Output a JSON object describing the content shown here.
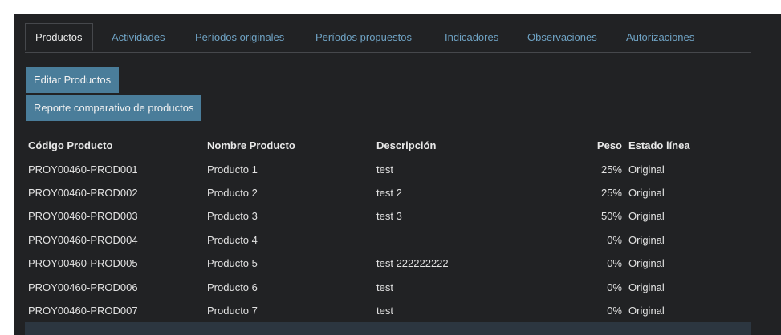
{
  "tabs": [
    {
      "label": "Productos",
      "active": true
    },
    {
      "label": "Actividades"
    },
    {
      "label": "Períodos originales"
    },
    {
      "label": "Períodos propuestos"
    },
    {
      "label": "Indicadores"
    },
    {
      "label": "Observaciones"
    },
    {
      "label": "Autorizaciones"
    }
  ],
  "buttons": {
    "edit": "Editar Productos",
    "report": "Reporte comparativo de productos"
  },
  "table": {
    "headers": {
      "code": "Código Producto",
      "name": "Nombre Producto",
      "desc": "Descripción",
      "peso": "Peso",
      "estado": "Estado línea"
    },
    "rows": [
      {
        "code": "PROY00460-PROD001",
        "name": "Producto 1",
        "desc": "test",
        "peso": "25%",
        "estado": "Original"
      },
      {
        "code": "PROY00460-PROD002",
        "name": "Producto 2",
        "desc": "test 2",
        "peso": "25%",
        "estado": "Original"
      },
      {
        "code": "PROY00460-PROD003",
        "name": "Producto 3",
        "desc": "test 3",
        "peso": "50%",
        "estado": "Original"
      },
      {
        "code": "PROY00460-PROD004",
        "name": "Producto 4",
        "desc": "",
        "peso": "0%",
        "estado": "Original"
      },
      {
        "code": "PROY00460-PROD005",
        "name": "Producto 5",
        "desc": "test 222222222",
        "peso": "0%",
        "estado": "Original"
      },
      {
        "code": "PROY00460-PROD006",
        "name": "Producto 6",
        "desc": "test",
        "peso": "0%",
        "estado": "Original"
      },
      {
        "code": "PROY00460-PROD007",
        "name": "Producto 7",
        "desc": "test",
        "peso": "0%",
        "estado": "Original"
      }
    ]
  },
  "colors": {
    "background": "#212224",
    "accent_tab": "#6fa3c4",
    "button": "#4a7d9a"
  }
}
